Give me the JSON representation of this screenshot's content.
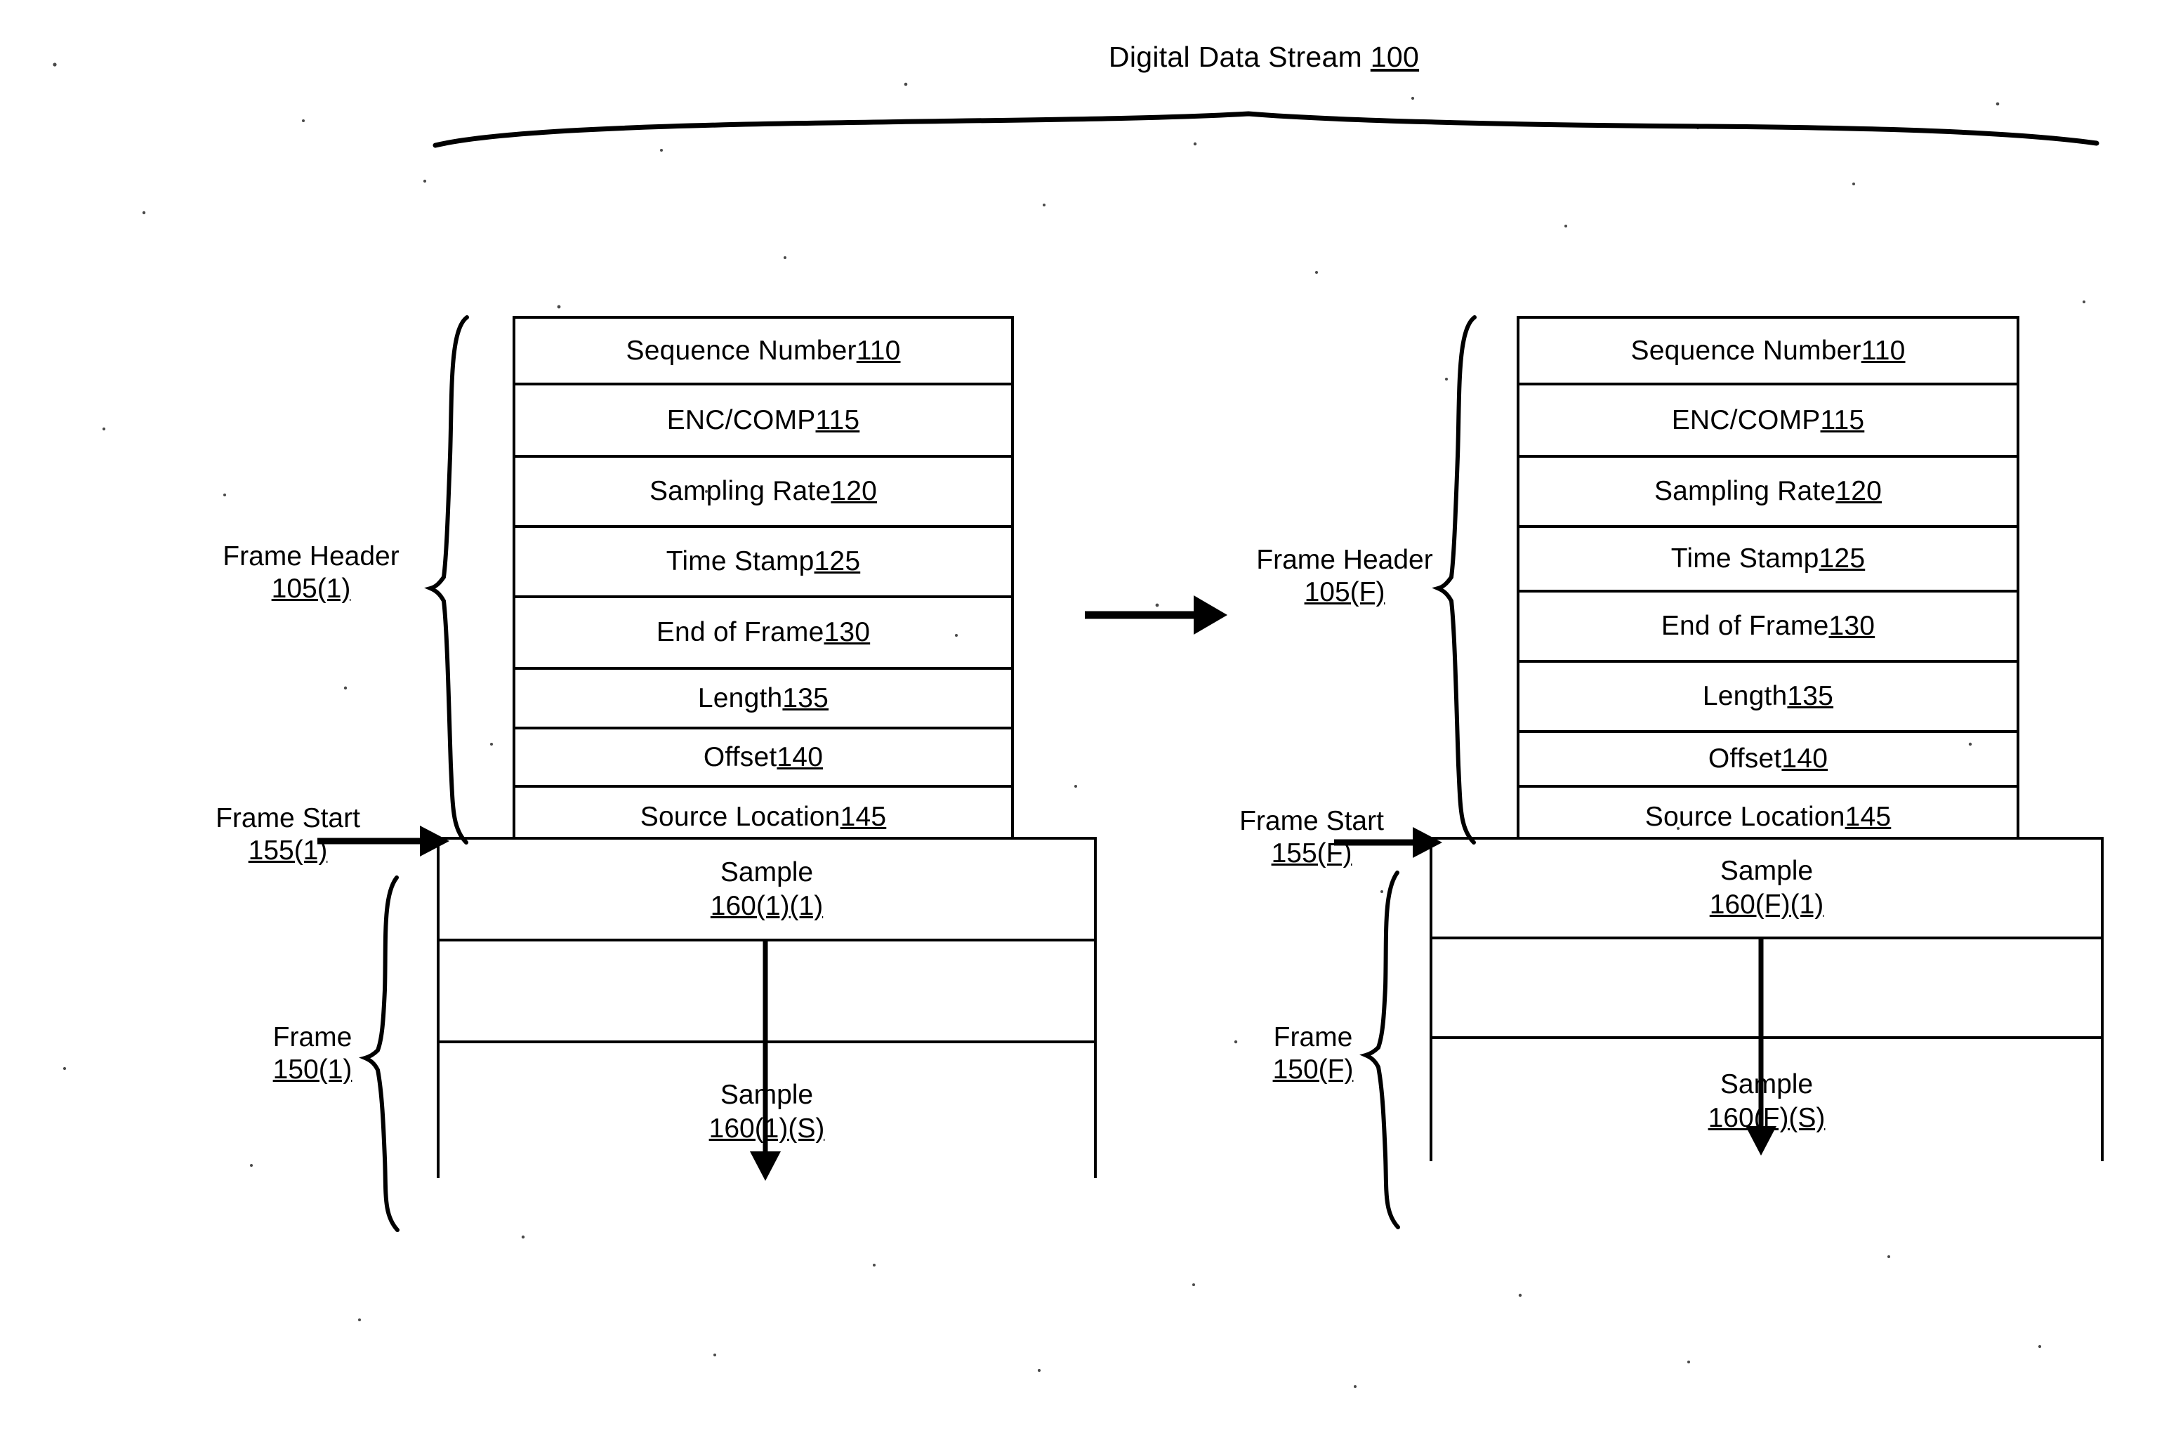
{
  "figure": {
    "title_text": "Digital Data Stream ",
    "title_ref": "100"
  },
  "header_fields": [
    {
      "label": "Sequence Number ",
      "ref": "110"
    },
    {
      "label": "ENC/COMP ",
      "ref": "115"
    },
    {
      "label": "Sampling Rate ",
      "ref": "120"
    },
    {
      "label": "Time Stamp ",
      "ref": "125"
    },
    {
      "label": "End of Frame ",
      "ref": "130"
    },
    {
      "label": "Length ",
      "ref": "135"
    },
    {
      "label": "Offset ",
      "ref": "140"
    },
    {
      "label": "Source Location ",
      "ref": "145"
    }
  ],
  "frames": [
    {
      "id": "frame-1",
      "header_label": "Frame Header",
      "header_ref": "105(1)",
      "start_label": "Frame Start",
      "start_ref": "155(1)",
      "frame_label": "Frame",
      "frame_ref": "150(1)",
      "samples": [
        {
          "label": "Sample",
          "ref": "160(1)(1)"
        },
        {
          "label": "Sample",
          "ref": "160(1)(S)"
        }
      ],
      "fields": [
        {
          "label": "Sequence Number ",
          "ref": "110"
        },
        {
          "label": "ENC/COMP ",
          "ref": "115"
        },
        {
          "label": "Sampling Rate ",
          "ref": "120"
        },
        {
          "label": "Time Stamp ",
          "ref": "125"
        },
        {
          "label": "End of Frame ",
          "ref": "130"
        },
        {
          "label": "Length ",
          "ref": "135"
        },
        {
          "label": "Offset ",
          "ref": "140"
        },
        {
          "label": "Source Location ",
          "ref": "145"
        }
      ]
    },
    {
      "id": "frame-F",
      "header_label": "Frame Header",
      "header_ref": "105(F)",
      "start_label": "Frame Start",
      "start_ref": "155(F)",
      "frame_label": "Frame",
      "frame_ref": "150(F)",
      "samples": [
        {
          "label": "Sample",
          "ref": "160(F)(1)"
        },
        {
          "label": "Sample",
          "ref": "160(F)(S)"
        }
      ],
      "fields": [
        {
          "label": "Sequence Number ",
          "ref": "110"
        },
        {
          "label": "ENC/COMP ",
          "ref": "115"
        },
        {
          "label": "Sampling Rate ",
          "ref": "120"
        },
        {
          "label": "Time Stamp ",
          "ref": "125"
        },
        {
          "label": "End of Frame ",
          "ref": "130"
        },
        {
          "label": "Length ",
          "ref": "135"
        },
        {
          "label": "Offset ",
          "ref": "140"
        },
        {
          "label": "Source Location ",
          "ref": "145"
        }
      ]
    }
  ],
  "colors": {
    "ink": "#000000",
    "paper": "#ffffff"
  }
}
